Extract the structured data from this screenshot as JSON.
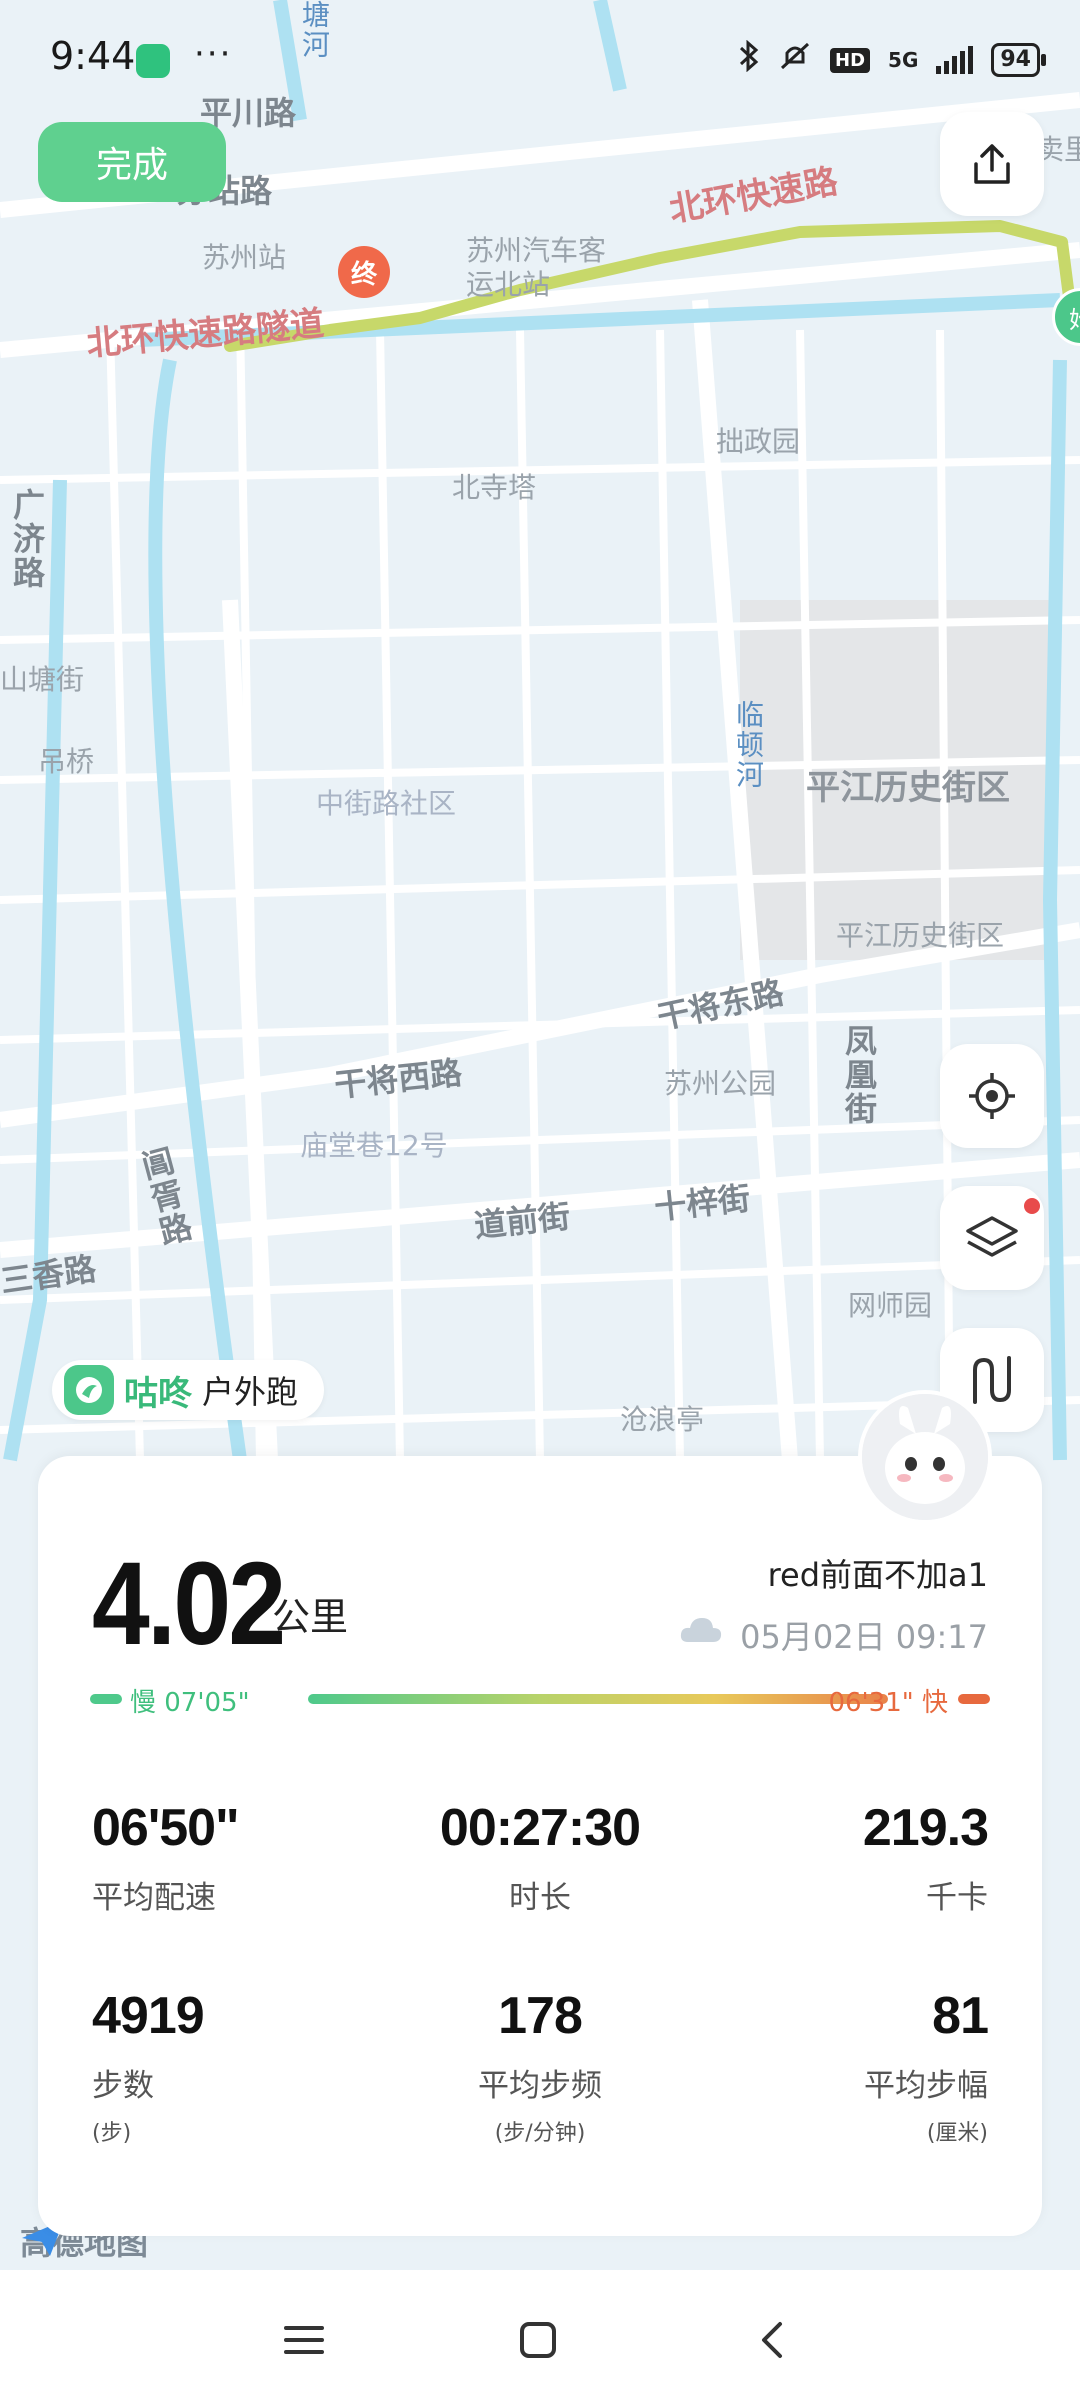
{
  "status_bar": {
    "time": "9:44",
    "dots": "···",
    "network": "5G",
    "hd": "HD",
    "battery": "94"
  },
  "header": {
    "done_label": "完成"
  },
  "map": {
    "labels": {
      "pingchuan_road": "平川路",
      "station_road": "苏站路",
      "suzhou_station": "苏州站",
      "bus_station": "苏州汽车客运北站",
      "north_ring_top": "北环快速路",
      "north_ring_tunnel": "北环快速路隧道",
      "humble_garden": "拙政园",
      "north_temple_pagoda": "北寺塔",
      "shantang_street": "山塘街",
      "diao_bridge": "吊桥",
      "zhongjie_community": "中街路社区",
      "lindun_river": "临顿河",
      "pingjiang_historic_1": "平江历史街区",
      "pingjiang_historic_2": "平江历史街区",
      "ganjiang_east": "干将东路",
      "ganjiang_west": "干将西路",
      "suzhou_park": "苏州公园",
      "fenghuang_street": "凤凰街",
      "miaotang_lane": "庙堂巷12号",
      "daoqian_street": "道前街",
      "shizi_street": "十梓街",
      "changxu_road": "阊胥路",
      "sanxiang_road": "三香路",
      "master_nets_garden": "网师园",
      "canglang_pavilion": "沧浪亭",
      "guangji_road": "广济路",
      "tang_river": "塘河",
      "mai_li": "卖里",
      "end_marker": "终",
      "start_marker": "始"
    },
    "provider": "高德地图",
    "colors": {
      "route": "#c7d86a",
      "end_marker": "#f0694a",
      "start_marker": "#4cc78a"
    }
  },
  "brand": {
    "name": "咕咚",
    "mode": "户外跑"
  },
  "summary": {
    "distance": "4.02",
    "distance_unit": "公里",
    "title": "red前面不加a1",
    "datetime": "05月02日 09:17",
    "weather_icon": "cloud-icon",
    "pace_slow": "慢 07'05\"",
    "pace_fast": "06'31\" 快"
  },
  "stats": [
    {
      "value": "06'50\"",
      "label": "平均配速",
      "unit": ""
    },
    {
      "value": "00:27:30",
      "label": "时长",
      "unit": ""
    },
    {
      "value": "219.3",
      "label": "千卡",
      "unit": ""
    },
    {
      "value": "4919",
      "label": "步数",
      "unit": "(步)"
    },
    {
      "value": "178",
      "label": "平均步频",
      "unit": "(步/分钟)"
    },
    {
      "value": "81",
      "label": "平均步幅",
      "unit": "(厘米)"
    }
  ],
  "nav": {
    "icons": [
      "menu-icon",
      "home-square-icon",
      "back-chevron-icon"
    ]
  }
}
